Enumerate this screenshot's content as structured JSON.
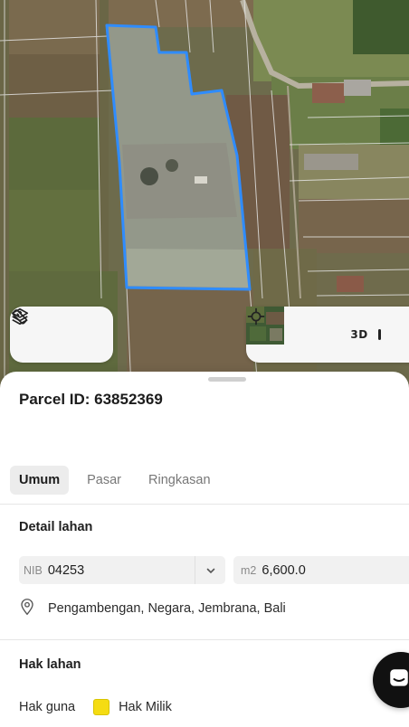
{
  "map": {
    "layers_icon": "layers-icon",
    "measure_icon": "ruler-icon",
    "locate_icon": "crosshair-icon",
    "mode_3d_label": "3D",
    "parcel_outline_color": "#2f8cff"
  },
  "parcel": {
    "title": "Parcel ID: 63852369"
  },
  "tabs": [
    {
      "label": "Umum",
      "active": true
    },
    {
      "label": "Pasar",
      "active": false
    },
    {
      "label": "Ringkasan",
      "active": false
    }
  ],
  "detail": {
    "section_title": "Detail lahan",
    "nib_prefix": "NIB",
    "nib_value": "04253",
    "area_prefix": "m2",
    "area_value": "6,600.0",
    "address": "Pengambengan, Negara, Jembrana, Bali"
  },
  "rights": {
    "section_title": "Hak lahan",
    "label": "Hak guna",
    "value": "Hak Milik",
    "swatch_color": "#f5dc12"
  }
}
